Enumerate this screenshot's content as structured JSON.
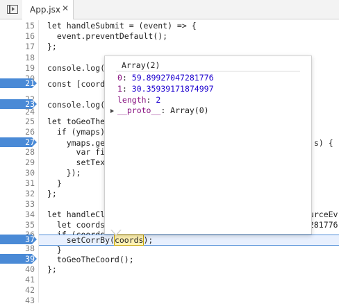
{
  "tab": {
    "label": "App.jsx",
    "close": "✕",
    "panel_icon": "panel-toggle-icon"
  },
  "gutter": {
    "lines": [
      "15",
      "16",
      "17",
      "18",
      "19",
      "20",
      "21",
      "22",
      "23",
      "24",
      "25",
      "26",
      "27",
      "28",
      "29",
      "30",
      "31",
      "32",
      "33",
      "34",
      "35",
      "36",
      "37",
      "38",
      "39",
      "40",
      "41",
      "42",
      "43"
    ],
    "breakpoints": [
      "21",
      "23",
      "27",
      "37",
      "39"
    ]
  },
  "code": {
    "l15": "let handleSubmit = (event) => {",
    "l16": "  event.preventDefault();",
    "l17": "};",
    "l19": "console.log('",
    "l21": "const [coord,",
    "l23": "console.log('",
    "l25": "let toGeoTheC",
    "l26": "  if (ymaps)",
    "l27a": "    ymaps.geo",
    "l27b": "s) {",
    "l28": "      var fir",
    "l29": "      setText",
    "l30": "    });",
    "l31": "  }",
    "l32": "};",
    "l34a": "let handleCli",
    "l34b": "ourceEv",
    "l35a": "  let coords",
    "l35b": "7281776",
    "l36": "  if (coords) {",
    "l37_pre": "    setCorrBy(",
    "l37_token": "coords",
    "l37_post": ");",
    "l38": "  }",
    "l39": "  toGeoTheCoord();",
    "l40": "};"
  },
  "popup": {
    "title": "Array(2)",
    "rows": [
      {
        "key": "0",
        "sep": ": ",
        "value": "59.89927047281776"
      },
      {
        "key": "1",
        "sep": ": ",
        "value": "30.35939171874997"
      },
      {
        "key": "length",
        "sep": ": ",
        "value": "2"
      },
      {
        "key": "__proto__",
        "sep": ": ",
        "value": "Array(0)"
      }
    ]
  },
  "colors": {
    "breakpoint": "#4a8ad6",
    "highlight_line": "#e8f0fe",
    "token_highlight": "#fff2b3"
  }
}
